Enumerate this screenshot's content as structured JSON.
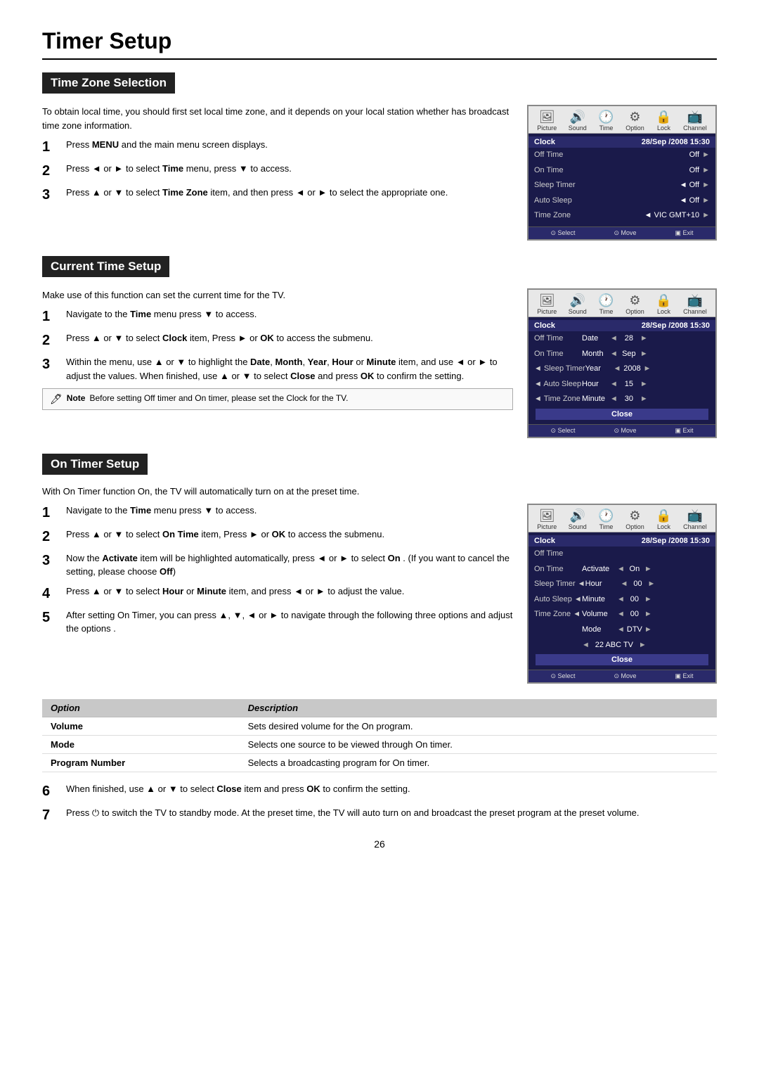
{
  "page": {
    "title": "Timer Setup",
    "page_number": "26"
  },
  "sections": {
    "time_zone": {
      "title": "Time Zone Selection",
      "intro": "To obtain local time, you should first set local time zone, and it depends on your local station whether has broadcast time zone information.",
      "steps": [
        {
          "num": "1",
          "text": "Press <b>MENU</b> and the main menu screen displays."
        },
        {
          "num": "2",
          "text": "Press ◄ or ► to select <b>Time</b> menu,  press ▼  to access."
        },
        {
          "num": "3",
          "text": "Press ▲ or ▼ to select <b>Time Zone</b> item, and then press ◄ or ► to select the appropriate one."
        }
      ],
      "screen": {
        "icons": [
          {
            "glyph": "🖼",
            "label": "Picture",
            "active": false
          },
          {
            "glyph": "🔊",
            "label": "Sound",
            "active": false
          },
          {
            "glyph": "🕐",
            "label": "Time",
            "active": true
          },
          {
            "glyph": "⚙",
            "label": "Option",
            "active": false
          },
          {
            "glyph": "🔒",
            "label": "Lock",
            "active": false
          },
          {
            "glyph": "📺",
            "label": "Channel",
            "active": false
          }
        ],
        "clock_label": "Clock",
        "clock_value": "28/Sep /2008 15:30",
        "rows": [
          {
            "label": "Off Time",
            "value": "Off",
            "arrow": "►",
            "indent": false
          },
          {
            "label": "On Time",
            "value": "Off",
            "arrow": "►",
            "indent": false
          },
          {
            "label": "Sleep Timer",
            "left_arrow": "◄",
            "value": "Off",
            "arrow": "►",
            "indent": false
          },
          {
            "label": "Auto Sleep",
            "left_arrow": "◄",
            "value": "Off",
            "arrow": "►",
            "indent": false
          },
          {
            "label": "Time Zone",
            "left_arrow": "◄",
            "value": "VIC GMT+10",
            "arrow": "►",
            "indent": false
          }
        ],
        "footer": [
          {
            "icon": "⊙",
            "label": "Select"
          },
          {
            "icon": "⊙",
            "label": "Move"
          },
          {
            "icon": "▣",
            "label": "Exit"
          }
        ]
      }
    },
    "current_time": {
      "title": "Current Time Setup",
      "intro": "Make use of this function can set the current time for the TV.",
      "steps": [
        {
          "num": "1",
          "text": "Navigate to the <b>Time</b> menu  press ▼  to access."
        },
        {
          "num": "2",
          "text": "Press ▲ or ▼ to select <b>Clock</b> item, Press ► or <b>OK</b> to access the submenu."
        },
        {
          "num": "3",
          "text": "Within the menu, use ▲ or ▼ to highlight the <b>Date</b>, <b>Month</b>, <b>Year</b>, <b>Hour</b> or <b>Minute</b> item, and use ◄ or ► to adjust the values. When finished, use ▲ or ▼ to select <b>Close</b> and press <b>OK</b> to confirm the setting."
        }
      ],
      "note": "Before setting Off timer and On timer, please set the Clock for the TV.",
      "screen": {
        "icons": [
          {
            "glyph": "🖼",
            "label": "Picture",
            "active": false
          },
          {
            "glyph": "🔊",
            "label": "Sound",
            "active": false
          },
          {
            "glyph": "🕐",
            "label": "Time",
            "active": true
          },
          {
            "glyph": "⚙",
            "label": "Option",
            "active": false
          },
          {
            "glyph": "🔒",
            "label": "Lock",
            "active": false
          },
          {
            "glyph": "📺",
            "label": "Channel",
            "active": false
          }
        ],
        "clock_label": "Clock",
        "clock_value": "28/Sep /2008 15:30",
        "rows": [
          {
            "label": "Off Time",
            "sub": [
              {
                "label": "Date",
                "left": "◄",
                "val": "28",
                "right": "►"
              }
            ]
          },
          {
            "label": "On Time",
            "sub": [
              {
                "label": "Month",
                "left": "◄",
                "val": "Sep",
                "right": "►"
              }
            ]
          },
          {
            "label": "Sleep Timer",
            "left_arrow": "◄",
            "sub": [
              {
                "label": "Year",
                "left": "◄",
                "val": "2008",
                "right": "►"
              }
            ]
          },
          {
            "label": "Auto Sleep",
            "left_arrow": "◄",
            "sub": [
              {
                "label": "Hour",
                "left": "◄",
                "val": "15",
                "right": "►"
              }
            ]
          },
          {
            "label": "Time Zone",
            "left_arrow": "◄",
            "sub": [
              {
                "label": "Minute",
                "left": "◄",
                "val": "30",
                "right": "►"
              }
            ]
          }
        ],
        "close_label": "Close",
        "footer": [
          {
            "icon": "⊙",
            "label": "Select"
          },
          {
            "icon": "⊙",
            "label": "Move"
          },
          {
            "icon": "▣",
            "label": "Exit"
          }
        ]
      }
    },
    "on_timer": {
      "title": "On Timer Setup",
      "intro": "With On Timer function On, the TV will automatically turn on at the preset time.",
      "steps": [
        {
          "num": "1",
          "text": "Navigate to the <b>Time</b> menu  press ▼  to access."
        },
        {
          "num": "2",
          "text": "Press ▲ or ▼ to select <b>On Time</b> item, Press ► or <b>OK</b> to access the submenu."
        },
        {
          "num": "3",
          "text": "Now the <b>Activate</b> item will be highlighted automatically, press ◄ or ► to select <b>On</b> . (If you want to cancel the setting, please choose <b>Off</b>)"
        },
        {
          "num": "4",
          "text": "Press ▲ or ▼ to select <b>Hour</b> or <b>Minute</b> item, and press ◄ or ► to adjust the value."
        },
        {
          "num": "5",
          "text": "After setting On Timer, you can press ▲, ▼, ◄ or ► to navigate through the following three options and adjust the options ."
        }
      ],
      "option_table": {
        "headers": [
          "Option",
          "Description"
        ],
        "rows": [
          {
            "option": "Volume",
            "description": "Sets desired volume for the On program."
          },
          {
            "option": "Mode",
            "description": "Selects one source to be viewed through On timer."
          },
          {
            "option": "Program Number",
            "description": "Selects a broadcasting program for On timer."
          }
        ]
      },
      "steps_after": [
        {
          "num": "6",
          "text": "When finished, use ▲ or ▼ to select <b>Close</b> item and press <b>OK</b> to confirm the setting."
        },
        {
          "num": "7",
          "text": "Press ⏻ to switch the TV to standby mode. At the preset time, the TV will auto turn on and broadcast the preset program at the preset volume."
        }
      ],
      "screen": {
        "icons": [
          {
            "glyph": "🖼",
            "label": "Picture",
            "active": false
          },
          {
            "glyph": "🔊",
            "label": "Sound",
            "active": false
          },
          {
            "glyph": "🕐",
            "label": "Time",
            "active": true
          },
          {
            "glyph": "⚙",
            "label": "Option",
            "active": false
          },
          {
            "glyph": "🔒",
            "label": "Lock",
            "active": false
          },
          {
            "glyph": "📺",
            "label": "Channel",
            "active": false
          }
        ],
        "clock_label": "Clock",
        "clock_value": "28/Sep /2008 15:30",
        "rows": [
          {
            "label": "Off Time"
          },
          {
            "label": "On Time",
            "sub": [
              {
                "label": "Activate",
                "left": "◄",
                "val": "On",
                "right": "►"
              }
            ]
          },
          {
            "label": "Sleep Timer",
            "left_arrow": "◄",
            "sub": [
              {
                "label": "Hour",
                "left": "◄",
                "val": "00",
                "right": "►"
              }
            ]
          },
          {
            "label": "Auto Sleep",
            "left_arrow": "◄",
            "sub": [
              {
                "label": "Minute",
                "left": "◄",
                "val": "00",
                "right": "►"
              }
            ]
          },
          {
            "label": "Time Zone",
            "left_arrow": "◄",
            "sub": [
              {
                "label": "Volume",
                "left": "◄",
                "val": "00",
                "right": "►"
              }
            ]
          },
          {
            "sub_only": true,
            "sub": [
              {
                "label": "Mode",
                "left": "◄",
                "val": "DTV",
                "right": "►"
              }
            ]
          },
          {
            "sub_only": true,
            "sub_wide": true,
            "sub": [
              {
                "label": "◄",
                "val": "22 ABC TV",
                "right": "►"
              }
            ]
          }
        ],
        "close_label": "Close",
        "footer": [
          {
            "icon": "⊙",
            "label": "Select"
          },
          {
            "icon": "⊙",
            "label": "Move"
          },
          {
            "icon": "▣",
            "label": "Exit"
          }
        ]
      }
    }
  }
}
